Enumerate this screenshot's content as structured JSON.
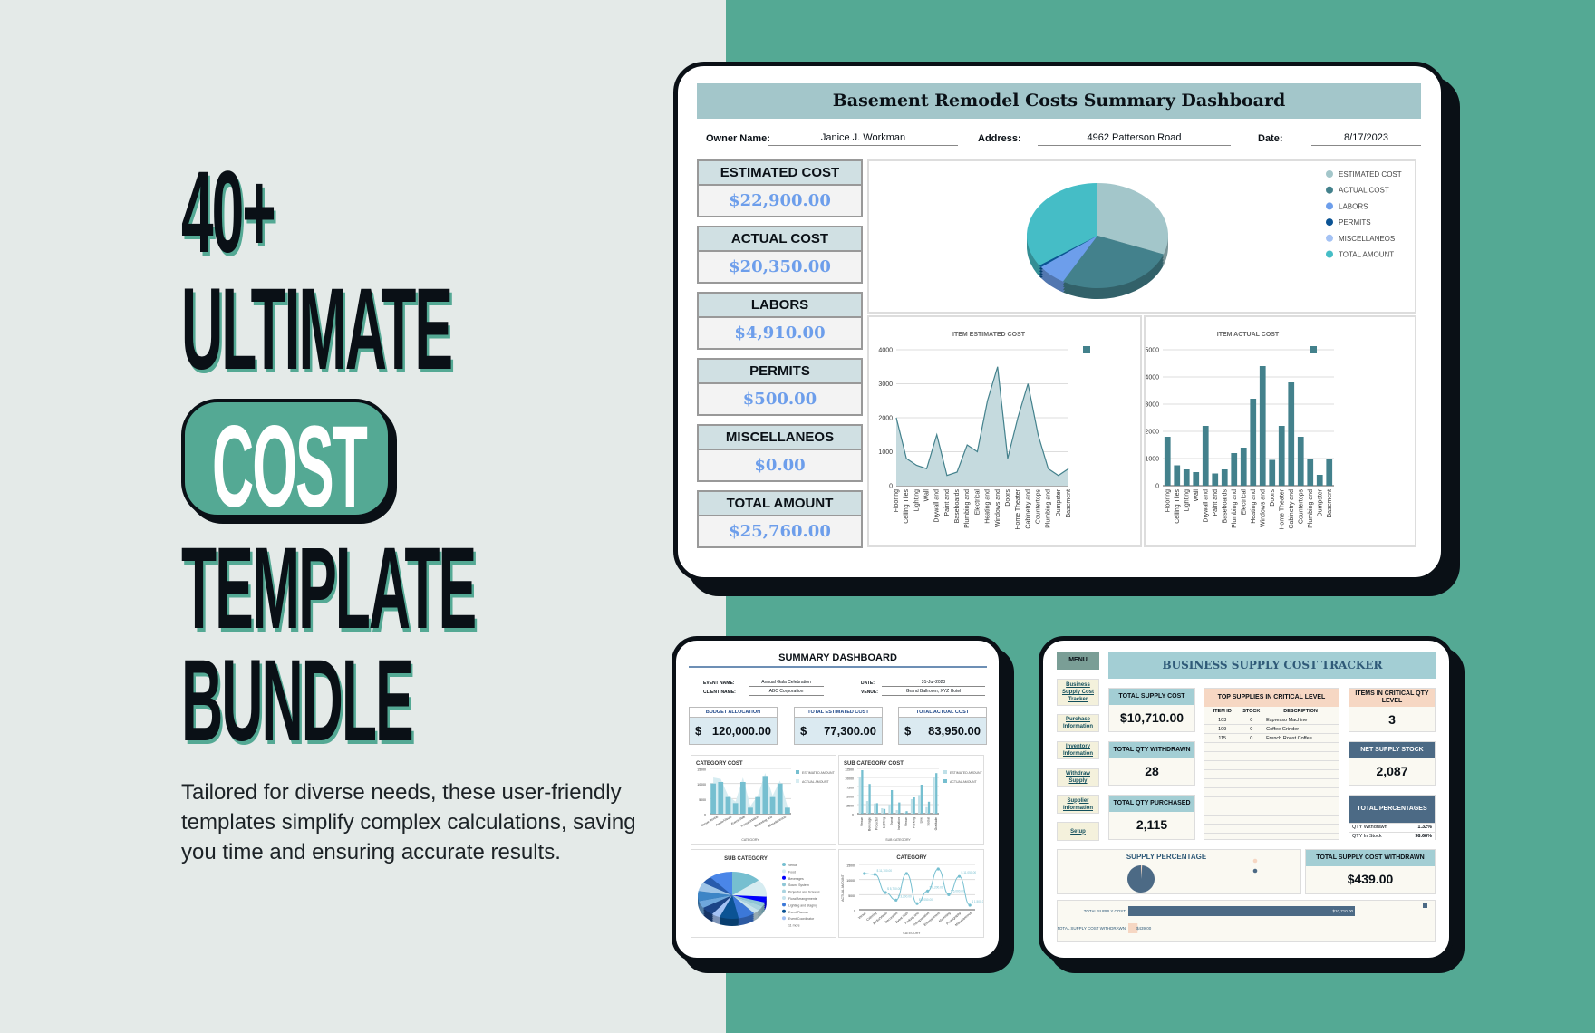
{
  "promo": {
    "headline_line1": "40+",
    "headline_line2": "ULTIMATE",
    "headline_highlight": "COST",
    "headline_line4": "TEMPLATE",
    "headline_line5": "BUNDLE",
    "description": "Tailored for diverse needs, these user-friendly templates simplify complex calculations, saving you time and ensuring accurate results.",
    "colors": {
      "accent": "#54a994",
      "dark": "#0a1016",
      "background": "#e4eae8"
    }
  },
  "basement_dashboard": {
    "title": "Basement Remodel Costs Summary Dashboard",
    "owner_label": "Owner Name:",
    "owner_value": "Janice J. Workman",
    "address_label": "Address:",
    "address_value": "4962 Patterson Road",
    "date_label": "Date:",
    "date_value": "8/17/2023",
    "kpis": [
      {
        "label": "ESTIMATED COST",
        "value": "$22,900.00"
      },
      {
        "label": "ACTUAL COST",
        "value": "$20,350.00"
      },
      {
        "label": "LABORS",
        "value": "$4,910.00"
      },
      {
        "label": "PERMITS",
        "value": "$500.00"
      },
      {
        "label": "MISCELLANEOS",
        "value": "$0.00"
      },
      {
        "label": "TOTAL AMOUNT",
        "value": "$25,760.00"
      }
    ]
  },
  "chart_data": [
    {
      "type": "pie",
      "labels": [
        "ESTIMATED COST",
        "ACTUAL COST",
        "LABORS",
        "PERMITS",
        "MISCELLANEOS",
        "TOTAL AMOUNT"
      ],
      "values": [
        22900,
        20350,
        4910,
        500,
        0,
        25760
      ],
      "colors": [
        "#a3c6ca",
        "#43818c",
        "#6d9eeb",
        "#0b5394",
        "#a4c2f4",
        "#45bdc6"
      ],
      "legend": "right",
      "style": "3d"
    },
    {
      "type": "area",
      "title": "ITEM ESTIMATED COST",
      "categories": [
        "Flooring",
        "Ceiling Tiles",
        "Lighting",
        "Wall",
        "Drywall and",
        "Paint and",
        "Baseboards",
        "Plumbing and",
        "Electrical",
        "Heating and",
        "Windows and",
        "Doors",
        "Home Theater",
        "Cabinetry and",
        "Countertops",
        "Plumbing and",
        "Dumpster",
        "Basement"
      ],
      "values": [
        2000,
        800,
        600,
        500,
        1500,
        300,
        400,
        1200,
        1000,
        2500,
        3500,
        800,
        2000,
        3000,
        1500,
        500,
        300,
        500
      ],
      "yticks": [
        0,
        1000,
        2000,
        3000,
        4000
      ],
      "ylim": [
        0,
        4000
      ],
      "grid": true,
      "color": "#43818c",
      "fill": "#c5dade",
      "legend": "top-right"
    },
    {
      "type": "bar",
      "title": "ITEM ACTUAL COST",
      "categories": [
        "Flooring",
        "Ceiling Tiles",
        "Lighting",
        "Wall",
        "Drywall and",
        "Paint and",
        "Baseboards",
        "Plumbing and",
        "Electrical",
        "Heating and",
        "Windows and",
        "Doors",
        "Home Theater",
        "Cabinetry and",
        "Countertops",
        "Plumbing and",
        "Dumpster",
        "Basement"
      ],
      "values": [
        1800,
        750,
        600,
        500,
        2200,
        450,
        600,
        1200,
        1400,
        3200,
        4400,
        950,
        2200,
        3800,
        1800,
        1000,
        400,
        1000
      ],
      "yticks": [
        0,
        1000,
        2000,
        3000,
        4000,
        5000
      ],
      "ylim": [
        0,
        5000
      ],
      "grid": true,
      "color": "#43818c",
      "legend": "top-right"
    },
    {
      "type": "bar",
      "title": "CATEGORY COST",
      "xlabel": "CATEGORY",
      "categories": [
        "Venue Rental",
        "Audio/Visual",
        "Event Staff",
        "Transportation",
        "Marketing and",
        "Miscellaneous"
      ],
      "series": [
        {
          "name": "ESTIMATED AMOUNT",
          "values": [
            10000,
            10500,
            5500,
            3500,
            10500,
            2000,
            5500,
            12500,
            5500,
            10000,
            2000
          ]
        },
        {
          "name": "ACTUAL AMOUNT",
          "values": [
            12000,
            11500,
            6000,
            4000,
            12000,
            2500,
            6000,
            13500,
            6000,
            11000,
            2500
          ]
        }
      ],
      "yticks": [
        0,
        5000,
        10000,
        15000
      ],
      "ylim": [
        0,
        15000
      ],
      "colors": [
        "#76bfd0",
        "#d6ecf1"
      ]
    },
    {
      "type": "bar",
      "title": "SUB CATEGORY COST",
      "xlabel": "SUB CATEGORY",
      "categories": [
        "Venue",
        "Beverage",
        "Projector",
        "Lighting",
        "Event",
        "Invitation",
        "Venue",
        "Parking",
        "Live",
        "Social",
        "Gratitude"
      ],
      "series": [
        {
          "name": "ESTIMATED AMOUNT",
          "values": [
            10000,
            3500,
            2800,
            1500,
            2500,
            1000,
            300,
            4000,
            5200,
            1800,
            10000
          ]
        },
        {
          "name": "ACTUAL AMOUNT",
          "values": [
            12000,
            8200,
            2900,
            1300,
            6500,
            3100,
            700,
            4500,
            8000,
            3300,
            11200
          ]
        }
      ],
      "yticks": [
        0,
        2500,
        5000,
        7500,
        10000,
        12500
      ],
      "ylim": [
        0,
        12500
      ],
      "colors": [
        "#bfe0e8",
        "#76bfd0"
      ]
    },
    {
      "type": "pie",
      "title": "SUB CATEGORY",
      "labels": [
        "Venue",
        "Food",
        "Beverages",
        "Sound System",
        "Projector and Screens",
        "Floral Arrangements",
        "Lighting and Staging",
        "Event Planner",
        "Event Coordinator"
      ],
      "more_label": "11 more",
      "values": [
        14,
        12,
        4,
        3,
        3,
        3,
        8,
        9,
        4,
        6,
        5,
        7,
        6,
        5,
        11
      ],
      "colors": [
        "#76bfd0",
        "#d6ecf1",
        "#0000ff",
        "#8fc7d6",
        "#a9d3df",
        "#c6e3ec",
        "#3c78d8",
        "#0b5394",
        "#a4c2f4",
        "#1c4587",
        "#6fa8dc",
        "#3d85c6",
        "#9fc5e8",
        "#285bac",
        "#4a86e8"
      ],
      "style": "3d",
      "legend": "right"
    },
    {
      "type": "line",
      "title": "CATEGORY",
      "xlabel": "CATEGORY",
      "ylabel": "ACTUAL AMOUNT",
      "categories": [
        "Venue",
        "Catering",
        "Audio/Visual",
        "Decoration",
        "Event Staff",
        "Parking and",
        "Transportation",
        "Entertainment",
        "Marketing",
        "Photography",
        "Miscellaneous"
      ],
      "values": [
        12000,
        11700,
        5700,
        3200,
        12000,
        2050,
        6200,
        13500,
        5000,
        11050,
        1500
      ],
      "data_labels": [
        "",
        "$ 11,700.00",
        "$ 5,700.00",
        "$ 3,200.00",
        "",
        "$ 2,050.00",
        "$ 6,200.00",
        "",
        "$ 5,000.00",
        "$ 11,050.00",
        "$ 1,500.00"
      ],
      "yticks": [
        0,
        5000,
        10000,
        15000
      ],
      "ylim": [
        0,
        15000
      ],
      "color": "#76bfd0"
    },
    {
      "type": "pie",
      "title": "SUPPLY PERCENTAGE",
      "labels": [
        "QTY Withdrawn",
        "QTY In Stock"
      ],
      "values": [
        1.32,
        98.68
      ],
      "colors": [
        "#f6d7c3",
        "#4c6a85"
      ]
    },
    {
      "type": "bar",
      "orientation": "horizontal",
      "categories": [
        "TOTAL SUPPLY COST",
        "TOTAL SUPPLY COST WITHDRAWN"
      ],
      "values": [
        10710,
        439
      ],
      "data_labels": [
        "$10,710.00",
        "$439.00"
      ],
      "colors": [
        "#4c6a85",
        "#f6d7c3"
      ]
    }
  ],
  "event_dashboard": {
    "title": "SUMMARY DASHBOARD",
    "event_name_label": "EVENT NAME:",
    "event_name_value": "Annual Gala Celebration",
    "client_name_label": "CLIENT NAME:",
    "client_name_value": "ABC Corporation",
    "date_label": "DATE:",
    "date_value": "31-Jul-2023",
    "venue_label": "VENUE:",
    "venue_value": "Grand Ballroom, XYZ Hotel",
    "kpis": [
      {
        "label": "BUDGET ALLOCATION",
        "currency": "$",
        "value": "120,000.00"
      },
      {
        "label": "TOTAL ESTIMATED COST",
        "currency": "$",
        "value": "77,300.00"
      },
      {
        "label": "TOTAL ACTUAL COST",
        "currency": "$",
        "value": "83,950.00"
      }
    ]
  },
  "supply_tracker": {
    "menu_label": "MENU",
    "title": "BUSINESS SUPPLY COST TRACKER",
    "menu_items": [
      "Business Supply Cost Tracker",
      "Purchase Information",
      "Inventory Information",
      "Withdraw Supply",
      "Supplier Information",
      "Setup"
    ],
    "total_supply_cost_label": "TOTAL SUPPLY COST",
    "total_supply_cost": "$10,710.00",
    "total_qty_withdrawn_label": "TOTAL QTY WITHDRAWN",
    "total_qty_withdrawn": "28",
    "total_qty_purchased_label": "TOTAL QTY PURCHASED",
    "total_qty_purchased": "2,115",
    "critical_table": {
      "title": "TOP SUPPLIES IN CRITICAL LEVEL",
      "columns": [
        "ITEM ID",
        "STOCK",
        "DESCRIPTION"
      ],
      "rows": [
        [
          "103",
          "0",
          "Espresso Machine"
        ],
        [
          "109",
          "0",
          "Coffee Grinder"
        ],
        [
          "115",
          "0",
          "French Roast Coffee"
        ]
      ]
    },
    "critical_items_label": "ITEMS IN CRITICAL QTY LEVEL",
    "critical_items": "3",
    "net_supply_stock_label": "NET SUPPLY STOCK",
    "net_supply_stock": "2,087",
    "total_percentages_label": "TOTAL PERCENTAGES",
    "percentages": [
      {
        "label": "QTY Withdrawn",
        "value": "1.32%"
      },
      {
        "label": "QTY In Stock",
        "value": "98.68%"
      }
    ],
    "total_supply_cost_withdrawn_label": "TOTAL SUPPLY COST WITHDRAWN",
    "total_supply_cost_withdrawn": "$439.00"
  }
}
